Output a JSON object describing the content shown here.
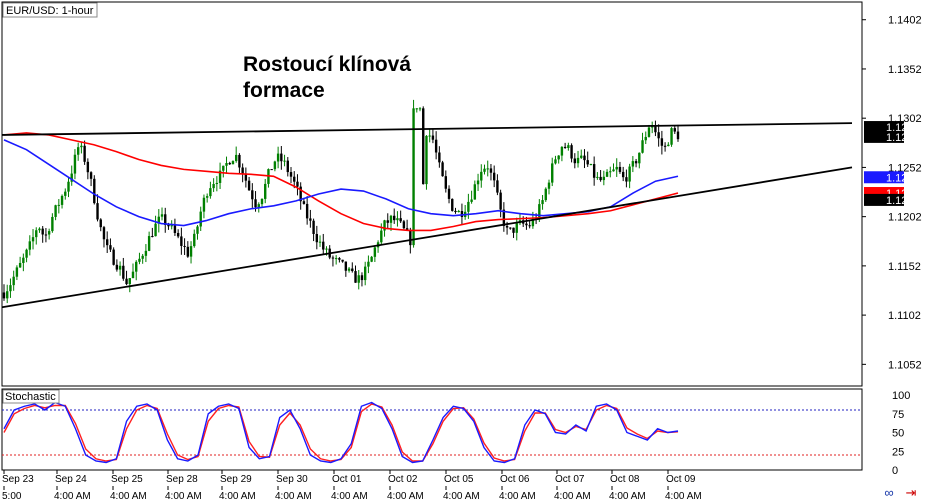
{
  "chart_data": [
    {
      "type": "candlestick",
      "title": "EUR/USD: 1-hour",
      "annotation_lines": [
        "Rostoucí klínová",
        "formace"
      ],
      "y_ticks": [
        "1.1402",
        "1.1352",
        "1.1302",
        "1.1252",
        "1.1202",
        "1.1152",
        "1.1102",
        "1.1052"
      ],
      "ylim": [
        1.103,
        1.142
      ],
      "price_tags": [
        {
          "text": "1.1293",
          "value": 1.1293,
          "bg": "#000000",
          "fg": "#ffffff"
        },
        {
          "text": "1.1283",
          "value": 1.1283,
          "bg": "#000000",
          "fg": "#ffffff"
        },
        {
          "text": "1.1242",
          "value": 1.1242,
          "bg": "#1a1aff",
          "fg": "#ffffff"
        },
        {
          "text": "1.1226",
          "value": 1.1226,
          "bg": "#ff0000",
          "fg": "#ffffff"
        },
        {
          "text": "1.1219",
          "value": 1.1219,
          "bg": "#000000",
          "fg": "#ffffff"
        }
      ],
      "date_labels": [
        "Sep 23",
        "Sep 24",
        "Sep 25",
        "Sep 28",
        "Sep 29",
        "Sep 30",
        "Oct 01",
        "Oct 02",
        "Oct 05",
        "Oct 06",
        "Oct 07",
        "Oct 08",
        "Oct 09"
      ],
      "time_labels": [
        "5:00",
        "4:00 AM",
        "4:00 AM",
        "4:00 AM",
        "4:00 AM",
        "4:00 AM",
        "4:00 AM",
        "4:00 AM",
        "4:00 AM",
        "4:00 AM",
        "4:00 AM",
        "4:00 AM",
        "4:00 AM"
      ],
      "close_path": [
        1.1125,
        1.1135,
        1.1148,
        1.116,
        1.1175,
        1.1195,
        1.118,
        1.12,
        1.1215,
        1.123,
        1.125,
        1.1275,
        1.1258,
        1.123,
        1.1195,
        1.117,
        1.116,
        1.115,
        1.1135,
        1.1145,
        1.116,
        1.1175,
        1.119,
        1.12,
        1.1195,
        1.1185,
        1.1175,
        1.1165,
        1.118,
        1.121,
        1.1232,
        1.124,
        1.1245,
        1.126,
        1.1265,
        1.125,
        1.123,
        1.1215,
        1.1225,
        1.1248,
        1.1262,
        1.1258,
        1.1245,
        1.123,
        1.121,
        1.1195,
        1.118,
        1.1168,
        1.116,
        1.1155,
        1.115,
        1.1142,
        1.1138,
        1.1145,
        1.116,
        1.118,
        1.1195,
        1.12,
        1.1195,
        1.1185,
        1.1175,
        1.116,
        1.129,
        1.128,
        1.125,
        1.1225,
        1.121,
        1.1205,
        1.1215,
        1.123,
        1.125,
        1.1255,
        1.1235,
        1.1205,
        1.1185,
        1.119,
        1.1195,
        1.1192,
        1.12,
        1.1215,
        1.124,
        1.1262,
        1.1275,
        1.127,
        1.1258,
        1.126,
        1.1252,
        1.124,
        1.1238,
        1.1245,
        1.125,
        1.124,
        1.1248,
        1.1262,
        1.128,
        1.13,
        1.1282,
        1.127,
        1.1288,
        1.1285
      ],
      "ma_blue": [
        1.128,
        1.127,
        1.1255,
        1.124,
        1.1225,
        1.1212,
        1.1202,
        1.1195,
        1.1193,
        1.1198,
        1.1205,
        1.121,
        1.1213,
        1.1218,
        1.1225,
        1.123,
        1.1228,
        1.122,
        1.121,
        1.1205,
        1.1203,
        1.1205,
        1.1208,
        1.1205,
        1.1203,
        1.1205,
        1.1207,
        1.1212,
        1.1226,
        1.1238,
        1.1243
      ],
      "ma_red": [
        1.1285,
        1.1287,
        1.1285,
        1.128,
        1.1275,
        1.1268,
        1.126,
        1.1254,
        1.125,
        1.1248,
        1.1246,
        1.1245,
        1.1243,
        1.1232,
        1.1218,
        1.1205,
        1.1195,
        1.119,
        1.1188,
        1.1188,
        1.1192,
        1.1197,
        1.1199,
        1.12,
        1.1201,
        1.1203,
        1.1205,
        1.1208,
        1.1214,
        1.122,
        1.1226
      ],
      "trend_upper": [
        [
          0,
          1.1285
        ],
        [
          1,
          1.1297
        ]
      ],
      "trend_lower": [
        [
          0,
          1.111
        ],
        [
          1,
          1.1252
        ]
      ]
    },
    {
      "type": "line",
      "title": "Stochastic",
      "y_ticks": [
        "100",
        "75",
        "50",
        "25",
        "0"
      ],
      "ylim": [
        0,
        100
      ],
      "levels": [
        80,
        20
      ],
      "k_line": [
        55,
        80,
        85,
        88,
        80,
        90,
        85,
        55,
        20,
        12,
        10,
        15,
        65,
        85,
        88,
        80,
        40,
        15,
        12,
        20,
        75,
        85,
        88,
        82,
        30,
        15,
        18,
        70,
        80,
        55,
        20,
        12,
        10,
        15,
        35,
        85,
        90,
        82,
        55,
        18,
        10,
        12,
        40,
        70,
        85,
        82,
        65,
        30,
        12,
        10,
        15,
        60,
        80,
        75,
        50,
        48,
        60,
        52,
        85,
        88,
        80,
        50,
        45,
        40,
        55,
        50,
        52
      ],
      "d_line": [
        50,
        75,
        82,
        86,
        83,
        86,
        86,
        62,
        28,
        15,
        12,
        14,
        55,
        80,
        86,
        82,
        48,
        20,
        14,
        18,
        65,
        82,
        86,
        84,
        38,
        18,
        17,
        60,
        76,
        60,
        28,
        15,
        12,
        14,
        30,
        78,
        88,
        84,
        60,
        24,
        12,
        12,
        35,
        65,
        82,
        83,
        68,
        36,
        16,
        12,
        14,
        52,
        76,
        76,
        54,
        50,
        58,
        54,
        80,
        86,
        82,
        56,
        48,
        42,
        52,
        50,
        51
      ],
      "colors": {
        "k": "#1a1aff",
        "d": "#ff2020",
        "ma_blue": "#1a1aff",
        "ma_red": "#ff0000",
        "candle_up": "#008000",
        "candle_down": "#000000"
      }
    }
  ]
}
